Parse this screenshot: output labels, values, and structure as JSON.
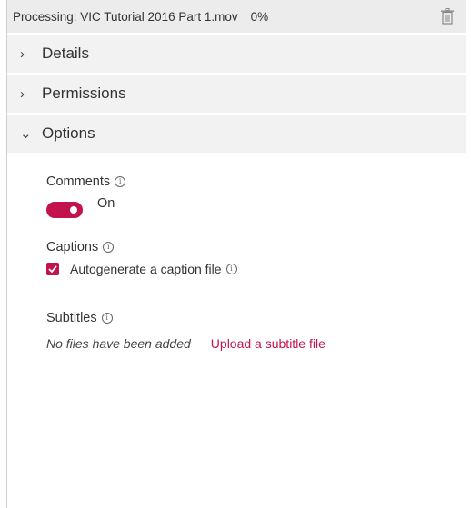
{
  "header": {
    "title": "Processing: VIC Tutorial 2016 Part 1.mov",
    "progress": "0%",
    "delete_icon": "trash-icon"
  },
  "sections": [
    {
      "label": "Details",
      "expanded": false
    },
    {
      "label": "Permissions",
      "expanded": false
    },
    {
      "label": "Options",
      "expanded": true
    }
  ],
  "options": {
    "comments": {
      "label": "Comments",
      "state_text": "On",
      "enabled": true
    },
    "captions": {
      "label": "Captions",
      "checkbox_label": "Autogenerate a caption file",
      "checked": true
    },
    "subtitles": {
      "label": "Subtitles",
      "empty_text": "No files have been added",
      "upload_link": "Upload a subtitle file"
    }
  },
  "colors": {
    "accent": "#c3134d",
    "section_bg": "#f2f2f2",
    "topbar_bg": "#ececec"
  }
}
